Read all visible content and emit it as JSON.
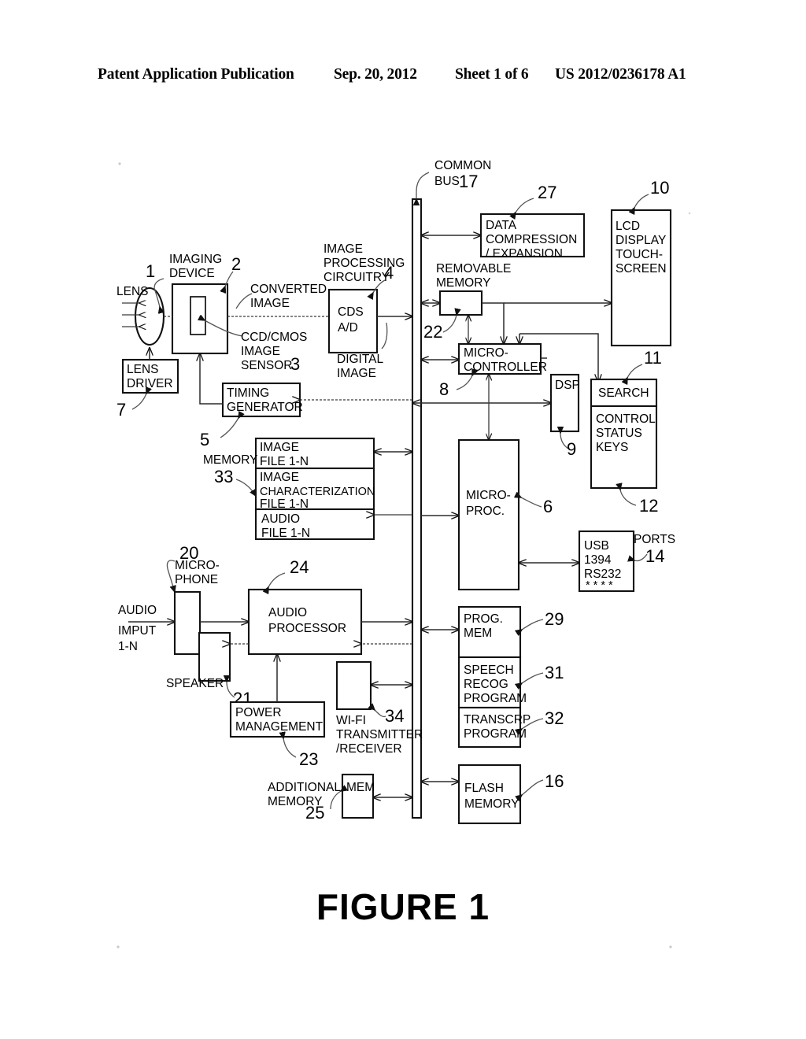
{
  "header": {
    "left": "Patent Application Publication",
    "date": "Sep. 20, 2012",
    "sheet": "Sheet 1 of 6",
    "number": "US 2012/0236178 A1"
  },
  "caption": "FIGURE 1",
  "colors": {
    "ink": "#000000",
    "line": "#1a1a1a",
    "paper": "#ffffff"
  },
  "figure": {
    "title": "FIGURE 1",
    "bus": {
      "label_line1": "COMMON",
      "label_line2": "BUS",
      "ref": "17"
    },
    "blocks": [
      {
        "id": "lens",
        "label": "LENS",
        "ref": "1",
        "shape": "ellipse"
      },
      {
        "id": "imaging-device",
        "label": "IMAGING DEVICE",
        "ref": "2",
        "shape": "rect"
      },
      {
        "id": "image-sensor",
        "label": "CCD/CMOS IMAGE SENSOR",
        "ref": "3",
        "shape": "rect"
      },
      {
        "id": "cds-ad",
        "label": "CDS A/D",
        "ref": "4",
        "shape": "rect"
      },
      {
        "id": "timing-generator",
        "label": "TIMING GENERATOR",
        "ref": "5",
        "shape": "rect"
      },
      {
        "id": "micro-proc",
        "label": "MICRO- PROC.",
        "ref": "6",
        "shape": "rect"
      },
      {
        "id": "lens-driver",
        "label": "LENS DRIVER",
        "ref": "7",
        "shape": "rect"
      },
      {
        "id": "micro-controller",
        "label": "MICRO- CONTROLLER",
        "ref": "8",
        "shape": "rect"
      },
      {
        "id": "dsp",
        "label": "DSP",
        "ref": "9",
        "shape": "rect"
      },
      {
        "id": "lcd-display",
        "label": "LCD DISPLAY TOUCH-SCREEN",
        "ref": "10",
        "shape": "rect"
      },
      {
        "id": "search",
        "label": "SEARCH",
        "ref": "11",
        "shape": "rect"
      },
      {
        "id": "control-keys",
        "label": "CONTROL STATUS KEYS",
        "ref": "12",
        "shape": "rect"
      },
      {
        "id": "ports",
        "label": "USB 1394 RS232 * * * *",
        "ref": "14",
        "shape": "rect"
      },
      {
        "id": "flash-memory",
        "label": "FLASH MEMORY",
        "ref": "16",
        "shape": "rect"
      },
      {
        "id": "microphone",
        "label": "MICRO- PHONE",
        "ref": "20",
        "shape": "rect"
      },
      {
        "id": "speaker",
        "label": "SPEAKER",
        "ref": "21",
        "shape": "rect"
      },
      {
        "id": "removable-memory",
        "label": "REMOVABLE MEMORY",
        "ref": "22",
        "shape": "rect"
      },
      {
        "id": "power-management",
        "label": "POWER MANAGEMENT",
        "ref": "23",
        "shape": "rect"
      },
      {
        "id": "audio-processor",
        "label": "AUDIO PROCESSOR",
        "ref": "24",
        "shape": "rect"
      },
      {
        "id": "additional-mem",
        "label": "MEM",
        "ref": "25",
        "shape": "rect"
      },
      {
        "id": "data-compression",
        "label": "DATA COMPRESSION / EXPANSION",
        "ref": "27",
        "shape": "rect"
      },
      {
        "id": "prog-mem",
        "label": "PROG. MEM",
        "ref": "29",
        "shape": "rect"
      },
      {
        "id": "speech-recog",
        "label": "SPEECH RECOG PROGRAM",
        "ref": "31",
        "shape": "rect"
      },
      {
        "id": "transcrp",
        "label": "TRANSCRP PROGRAM",
        "ref": "32",
        "shape": "rect"
      },
      {
        "id": "memory",
        "label": "MEMORY",
        "ref": "33",
        "shape": "rect"
      },
      {
        "id": "wifi",
        "label": "WI-FI TRANSMITTER /RECEIVER",
        "ref": "34",
        "shape": "rect"
      }
    ],
    "labels": {
      "lens": "LENS",
      "imaging_device_l1": "IMAGING",
      "imaging_device_l2": "DEVICE",
      "converted_image_l1": "CONVERTED",
      "converted_image_l2": "IMAGE",
      "ccd_l1": "CCD/CMOS",
      "ccd_l2": "IMAGE",
      "ccd_l3": "SENSOR",
      "img_proc_l1": "IMAGE",
      "img_proc_l2": "PROCESSING",
      "img_proc_l3": "CIRCUITRY",
      "cds": "CDS",
      "ad": "A/D",
      "digital_image_l1": "DIGITAL",
      "digital_image_l2": "IMAGE",
      "lens_driver_l1": "LENS",
      "lens_driver_l2": "DRIVER",
      "timing_l1": "TIMING",
      "timing_l2": "GENERATOR",
      "memory": "MEMORY",
      "image_file_l1": "IMAGE",
      "image_file_l2": "FILE 1-N",
      "image_char_l1": "IMAGE",
      "image_char_l2": "CHARACTERIZATION",
      "image_char_l3": "FILE 1-N",
      "audio_file_l1": "AUDIO",
      "audio_file_l2": "FILE 1-N",
      "common_bus_l1": "COMMON",
      "common_bus_l2": "BUS",
      "data_comp_l1": "DATA",
      "data_comp_l2": "COMPRESSION",
      "data_comp_l3": "/ EXPANSION",
      "removable_l1": "REMOVABLE",
      "removable_l2": "MEMORY",
      "lcd_l1": "LCD",
      "lcd_l2": "DISPLAY",
      "lcd_l3": "TOUCH-",
      "lcd_l4": "SCREEN",
      "microcontroller_l1": "MICRO-",
      "microcontroller_l2": "CONTROLLER",
      "dsp": "DSP",
      "search": "SEARCH",
      "control_l1": "CONTROL",
      "control_l2": "STATUS",
      "control_l3": "KEYS",
      "microproc_l1": "MICRO-",
      "microproc_l2": "PROC.",
      "usb": "USB",
      "p1394": "1394",
      "rs232": "RS232",
      "stars": "* * * *",
      "ports": "PORTS",
      "microphone_l1": "MICRO-",
      "microphone_l2": "PHONE",
      "audio_in_l1": "AUDIO",
      "audio_in_l2": "IMPUT",
      "audio_in_l3": "1-N",
      "audio_proc_l1": "AUDIO",
      "audio_proc_l2": "PROCESSOR",
      "speaker": "SPEAKER",
      "power_l1": "POWER",
      "power_l2": "MANAGEMENT",
      "wifi_l1": "WI-FI",
      "wifi_l2": "TRANSMITTER",
      "wifi_l3": "/RECEIVER",
      "prog_mem_l1": "PROG.",
      "prog_mem_l2": "MEM",
      "speech_l1": "SPEECH",
      "speech_l2": "RECOG",
      "speech_l3": "PROGRAM",
      "transcrp_l1": "TRANSCRP",
      "transcrp_l2": "PROGRAM",
      "addl_mem_l1": "ADDITIONAL",
      "addl_mem_l2": "MEMORY",
      "mem": "MEM",
      "flash_l1": "FLASH",
      "flash_l2": "MEMORY"
    },
    "refs": {
      "r1": "1",
      "r2": "2",
      "r3": "3",
      "r4": "4",
      "r5": "5",
      "r6": "6",
      "r7": "7",
      "r8": "8",
      "r9": "9",
      "r10": "10",
      "r11": "11",
      "r12": "12",
      "r14": "14",
      "r16": "16",
      "r17": "17",
      "r20": "20",
      "r21": "21",
      "r22": "22",
      "r23": "23",
      "r24": "24",
      "r25": "25",
      "r27": "27",
      "r29": "29",
      "r31": "31",
      "r32": "32",
      "r33": "33",
      "r34": "34"
    }
  }
}
